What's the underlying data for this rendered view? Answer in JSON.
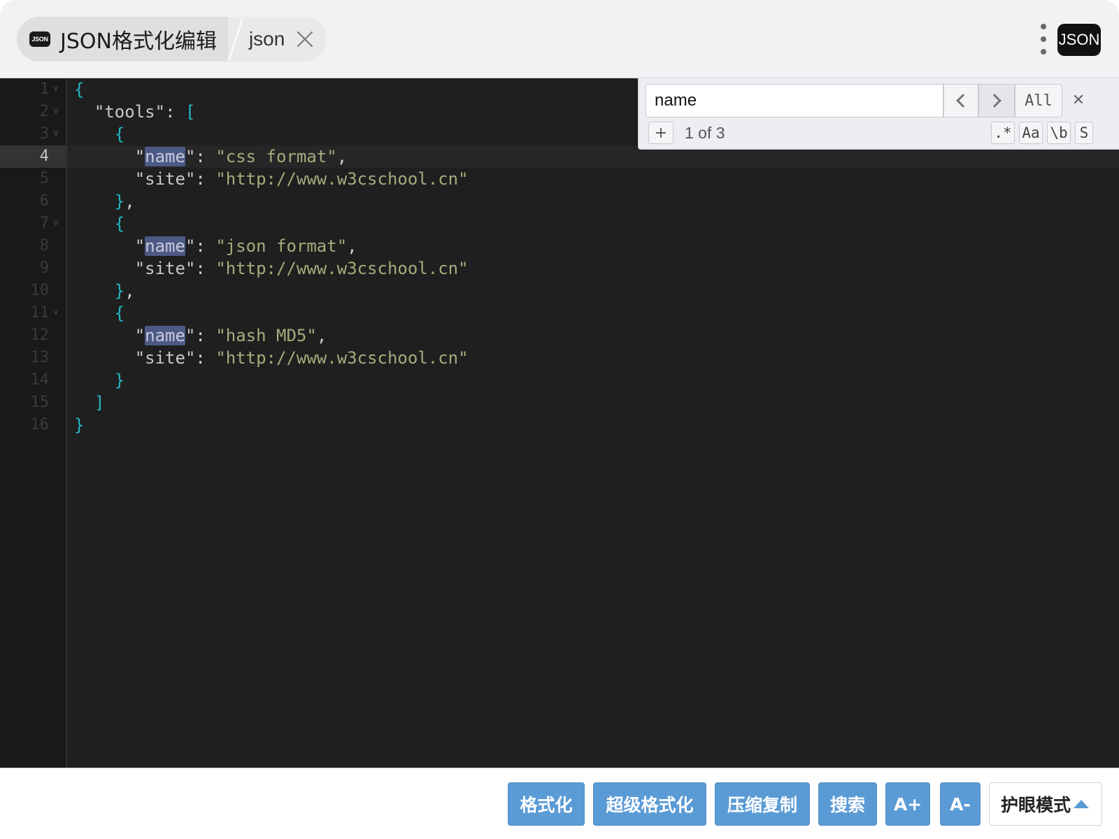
{
  "tab": {
    "badge": "JSON",
    "title": "JSON格式化编辑",
    "subtab_label": "json"
  },
  "header": {
    "badge": "JSON"
  },
  "editor": {
    "line_numbers": [
      "1",
      "2",
      "3",
      "4",
      "5",
      "6",
      "7",
      "8",
      "9",
      "10",
      "11",
      "12",
      "13",
      "14",
      "15",
      "16"
    ],
    "active_line": "4",
    "fold_markers": [
      "1",
      "2",
      "3",
      "7",
      "11"
    ]
  },
  "code": {
    "tools_key": "\"tools\"",
    "items": [
      {
        "name_value": "\"css format\"",
        "site_value": "\"http://www.w3cschool.cn\""
      },
      {
        "name_value": "\"json format\"",
        "site_value": "\"http://www.w3cschool.cn\""
      },
      {
        "name_value": "\"hash MD5\"",
        "site_value": "\"http://www.w3cschool.cn\""
      }
    ],
    "name_key": "name",
    "site_key": "\"site\""
  },
  "search": {
    "value": "name",
    "all_label": "All",
    "close_label": "✕",
    "replace_toggle": "+",
    "match_count": "1 of 3",
    "options": [
      ".*",
      "Aa",
      "\\b",
      "S"
    ]
  },
  "toolbar": {
    "format_label": "格式化",
    "super_format_label": "超级格式化",
    "compress_copy_label": "压缩复制",
    "search_label": "搜索",
    "font_up_label": "A+",
    "font_down_label": "A-",
    "eye_mode_label": "护眼模式"
  },
  "colors": {
    "editor_bg": "#1f1f1f",
    "bracket": "#23b8c4",
    "string": "#a3ad7c",
    "match_highlight": "#4d5a86",
    "button_blue": "#5b9bd5"
  }
}
